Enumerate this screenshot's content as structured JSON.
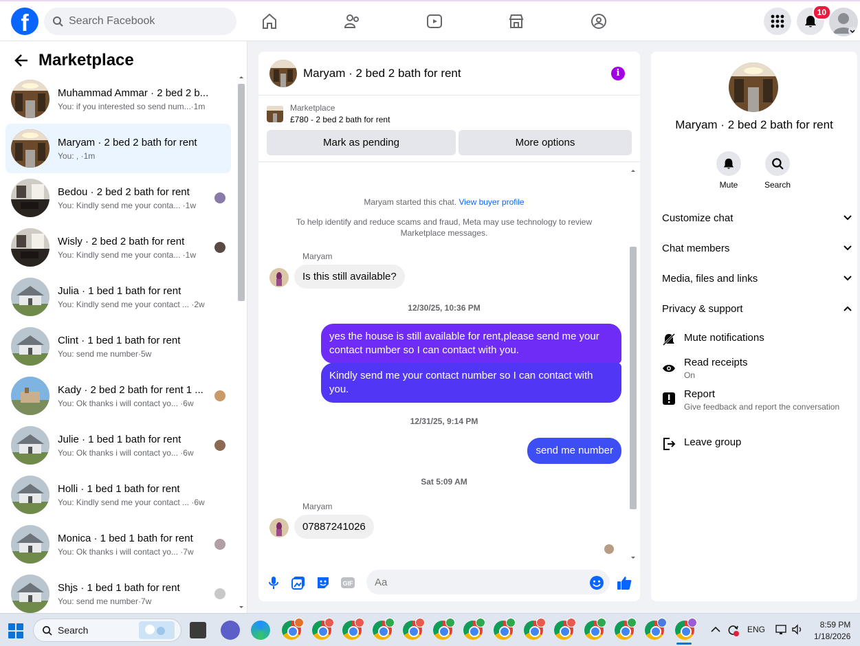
{
  "topbar": {
    "search_placeholder": "Search Facebook",
    "notifications_count": "10",
    "nav_icons": [
      "home-icon",
      "friends-icon",
      "video-icon",
      "marketplace-icon",
      "groups-icon"
    ]
  },
  "left": {
    "title": "Marketplace",
    "conversations": [
      {
        "title": "Muhammad Ammar · 2 bed 2 b...",
        "sub": "You: if you interested so send num...·1m",
        "thumb": "interior"
      },
      {
        "title": "Maryam · 2 bed 2 bath for rent",
        "sub": "You: , ·1m",
        "thumb": "interior"
      },
      {
        "title": "Bedou · 2 bed 2 bath for rent",
        "sub": "You: Kindly send me your conta... ·1w",
        "thumb": "dark"
      },
      {
        "title": "Wisly · 2 bed 2 bath for rent",
        "sub": "You: Kindly send me your conta... ·1w",
        "thumb": "dark"
      },
      {
        "title": "Julia · 1 bed 1 bath for rent",
        "sub": "You: Kindly send me your contact ... ·2w",
        "thumb": "house"
      },
      {
        "title": "Clint · 1 bed 1 bath for rent",
        "sub": "You: send me number·5w",
        "thumb": "house"
      },
      {
        "title": "Kady · 2 bed 2 bath for rent 1 ...",
        "sub": "You: Ok thanks i will contact yo... ·6w",
        "thumb": "sky"
      },
      {
        "title": "Julie · 1 bed 1 bath for rent",
        "sub": "You: Ok thanks i will contact yo... ·6w",
        "thumb": "house"
      },
      {
        "title": "Holli · 1 bed 1 bath for rent",
        "sub": "You: Kindly send me your contact ... ·6w",
        "thumb": "house"
      },
      {
        "title": "Monica · 1 bed 1 bath for rent",
        "sub": "You: Ok thanks i will contact yo... ·7w",
        "thumb": "house"
      },
      {
        "title": "Shjs · 1 bed 1 bath for rent",
        "sub": "You: send me number·7w",
        "thumb": "house"
      }
    ]
  },
  "chat": {
    "header_name": "Maryam · 2 bed 2 bath for rent",
    "marketplace_label": "Marketplace",
    "listing": "£780 - 2 bed 2 bath for rent",
    "mark_pending": "Mark as pending",
    "more_options": "More options",
    "started_text": "Maryam started this chat.",
    "buyer_profile_link": "View buyer profile",
    "scam_notice_1": "To help identify and reduce scams and fraud, Meta may use technology to review",
    "scam_notice_2": "Marketplace messages.",
    "sender_1": "Maryam",
    "msg_1": "Is this still available?",
    "time_1": "12/30/25, 10:36 PM",
    "out_1": "yes the house is still available for rent,please send me your contact number so I can contact with you.",
    "out_2": "Kindly send me your contact number so I can contact with you.",
    "time_2": "12/31/25, 9:14 PM",
    "out_3": "send me number",
    "time_3": "Sat 5:09 AM",
    "sender_2": "Maryam",
    "msg_2": "07887241026",
    "composer_placeholder": "Aa"
  },
  "right": {
    "name": "Maryam · 2 bed 2 bath for rent",
    "mute": "Mute",
    "search": "Search",
    "sections": [
      "Customize chat",
      "Chat members",
      "Media, files and links",
      "Privacy & support"
    ],
    "mute_notifications": "Mute notifications",
    "read_receipts": "Read receipts",
    "read_receipts_state": "On",
    "report": "Report",
    "report_sub": "Give feedback and report the conversation",
    "leave_group": "Leave group"
  },
  "taskbar": {
    "search_placeholder": "Search",
    "lang": "ENG",
    "time": "8:59 PM",
    "date": "1/18/2026"
  },
  "colors": {
    "accent": "#0866ff",
    "bubble_out_top": "#7b2ff7",
    "bubble_out_bottom": "#3b4ef5",
    "info": "#a200e3"
  }
}
